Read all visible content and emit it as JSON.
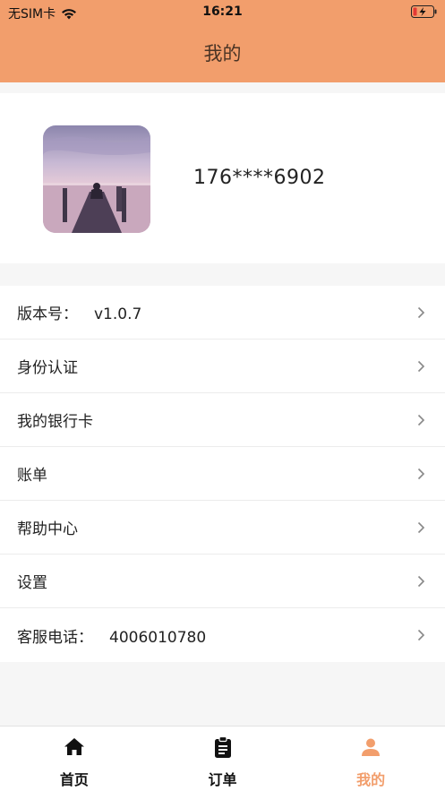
{
  "status": {
    "carrier": "无SIM卡",
    "time": "16:21"
  },
  "header": {
    "title": "我的"
  },
  "profile": {
    "phone": "176****6902"
  },
  "menu": [
    {
      "label": "版本号：",
      "value": "v1.0.7"
    },
    {
      "label": "身份认证"
    },
    {
      "label": "我的银行卡"
    },
    {
      "label": "账单"
    },
    {
      "label": "帮助中心"
    },
    {
      "label": "设置"
    },
    {
      "label": "客服电话：",
      "value": "4006010780"
    }
  ],
  "tabbar": {
    "items": [
      {
        "label": "首页",
        "icon": "home-icon"
      },
      {
        "label": "订单",
        "icon": "clipboard-icon"
      },
      {
        "label": "我的",
        "icon": "person-icon",
        "active": true
      }
    ]
  },
  "colors": {
    "accent": "#f29e6c",
    "background": "#f6f6f6"
  }
}
